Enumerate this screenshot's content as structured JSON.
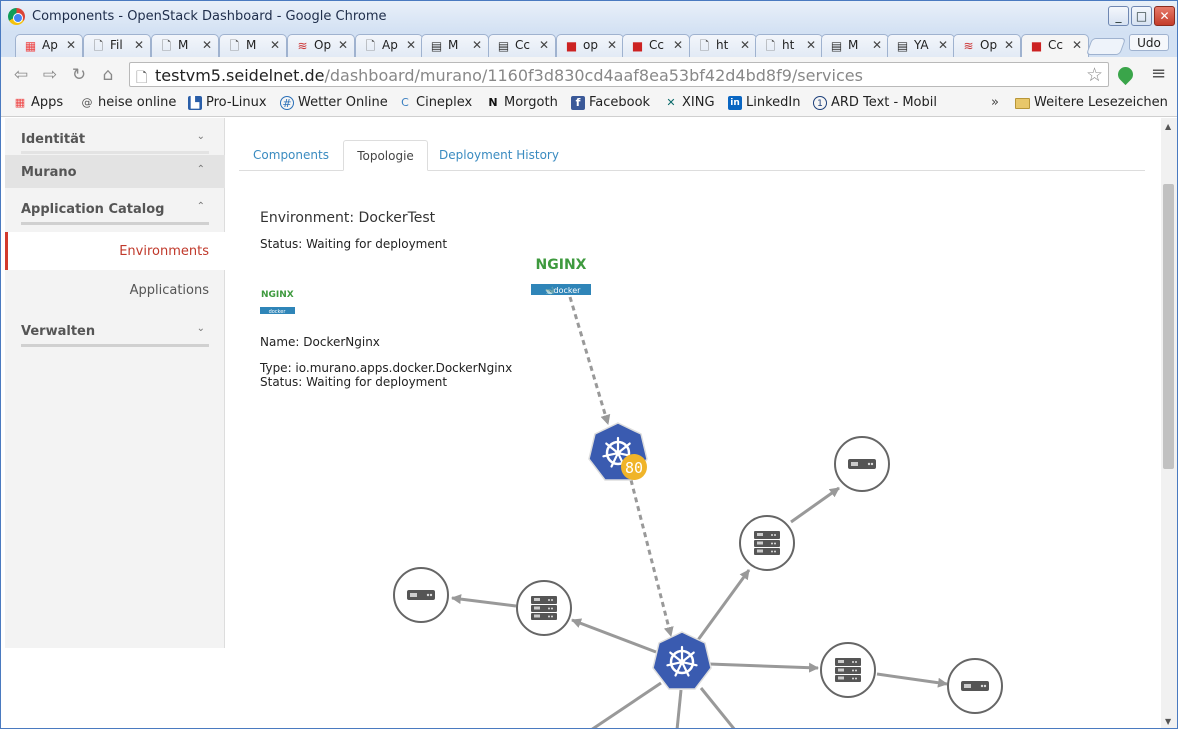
{
  "window": {
    "title": "Components - OpenStack Dashboard - Google Chrome",
    "minimize": "_",
    "maximize": "□",
    "close": "✕"
  },
  "tabs": [
    {
      "label": "Ap",
      "icon": "apps-grid-icon"
    },
    {
      "label": "Fil",
      "icon": "page-icon"
    },
    {
      "label": "M",
      "icon": "page-icon"
    },
    {
      "label": "M",
      "icon": "page-icon"
    },
    {
      "label": "Op",
      "icon": "openstack-icon"
    },
    {
      "label": "Ap",
      "icon": "page-icon"
    },
    {
      "label": "M",
      "icon": "calc-icon"
    },
    {
      "label": "Cc",
      "icon": "calc-icon"
    },
    {
      "label": "op",
      "icon": "red-square-icon"
    },
    {
      "label": "Cc",
      "icon": "red-square-icon"
    },
    {
      "label": "ht",
      "icon": "page-icon"
    },
    {
      "label": "ht",
      "icon": "page-icon"
    },
    {
      "label": "M",
      "icon": "calc-icon"
    },
    {
      "label": "YA",
      "icon": "calc-icon"
    },
    {
      "label": "Op",
      "icon": "openstack-icon"
    },
    {
      "label": "Cc",
      "icon": "red-square-icon"
    }
  ],
  "profile_name": "Udo",
  "address": {
    "host": "testvm5.seidelnet.de",
    "path": "/dashboard/murano/1160f3d830cd4aaf8ea53bf42d4bd8f9/services"
  },
  "bookmarks": [
    {
      "label": "Apps",
      "icon": "apps-grid-icon",
      "color": "#e44"
    },
    {
      "label": "heise online",
      "icon": "at-icon",
      "color": "#666"
    },
    {
      "label": "Pro-Linux",
      "icon": "prolinux-icon",
      "color": "#2a5ea8"
    },
    {
      "label": "Wetter Online",
      "icon": "globe-icon",
      "color": "#2a6fb8"
    },
    {
      "label": "Cineplex",
      "icon": "cineplex-icon",
      "color": "#3a7fc0"
    },
    {
      "label": "Morgoth",
      "icon": "n-icon",
      "color": "#111"
    },
    {
      "label": "Facebook",
      "icon": "facebook-icon",
      "color": "#3b5998"
    },
    {
      "label": "XING",
      "icon": "xing-icon",
      "color": "#0b6a6a"
    },
    {
      "label": "LinkedIn",
      "icon": "linkedin-icon",
      "color": "#0a66c2"
    },
    {
      "label": "ARD Text - Mobil",
      "icon": "ard-icon",
      "color": "#1c3f7a"
    }
  ],
  "bookmarks_overflow": "»",
  "bookmarks_folder": "Weitere Lesezeichen",
  "sidebar": {
    "sections": [
      {
        "label": "Identität",
        "chevron": "⌄"
      },
      {
        "label": "Murano",
        "chevron": "⌃"
      },
      {
        "label": "Application Catalog",
        "chevron": "⌃"
      },
      {
        "label": "Verwalten",
        "chevron": "⌄"
      }
    ],
    "items": [
      {
        "label": "Environments",
        "active": true
      },
      {
        "label": "Applications",
        "active": false
      }
    ]
  },
  "content_tabs": [
    {
      "label": "Components",
      "active": false
    },
    {
      "label": "Topologie",
      "active": true
    },
    {
      "label": "Deployment History",
      "active": false
    }
  ],
  "environment": {
    "title": "Environment: DockerTest",
    "status": "Status: Waiting for deployment"
  },
  "selected_app": {
    "logo_text": "NGINX",
    "logo_badge": "docker",
    "name": "Name: DockerNginx",
    "type": "Type: io.murano.apps.docker.DockerNginx",
    "status": "Status: Waiting for deployment"
  },
  "topology": {
    "app_logo_text": "NGINX",
    "app_badge": "docker",
    "port_badge": "80",
    "colors": {
      "kube": "#3a5bb0",
      "edge": "#999999",
      "port": "#f0b429",
      "node_stroke": "#666666"
    }
  }
}
